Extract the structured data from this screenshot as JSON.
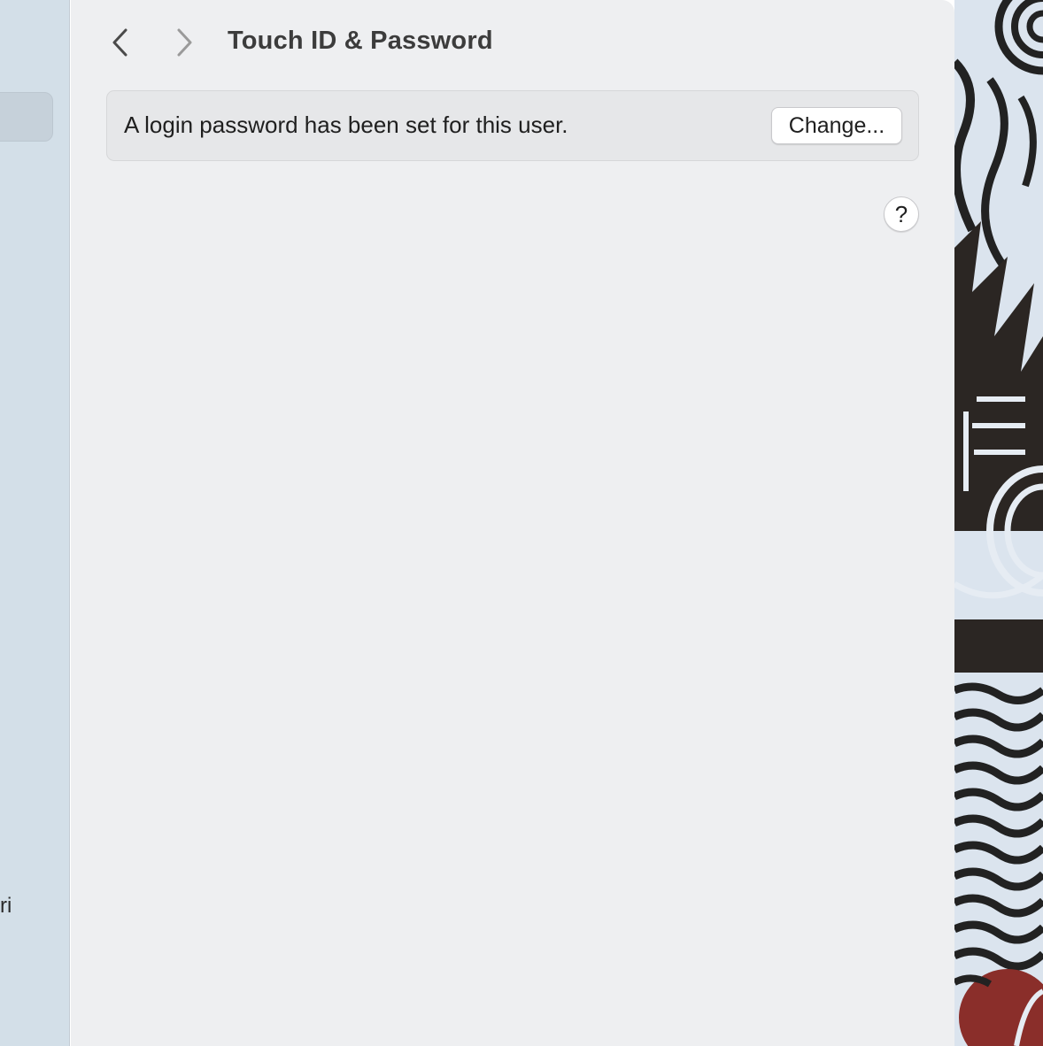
{
  "window": {
    "title": "Touch ID & Password"
  },
  "sidebar": {
    "partial_item_label": "ri"
  },
  "nav": {
    "back_icon": "chevron-left-icon",
    "forward_icon": "chevron-right-icon"
  },
  "password_section": {
    "message": "A login password has been set for this user.",
    "change_button_label": "Change..."
  },
  "help": {
    "label": "?"
  },
  "colors": {
    "sidebar_bg": "#d3dfe8",
    "content_bg": "#eeeff1",
    "group_bg": "#e6e7e9",
    "button_bg": "#ffffff",
    "text": "#1f1f1f",
    "title_text": "#3c3c3c"
  }
}
